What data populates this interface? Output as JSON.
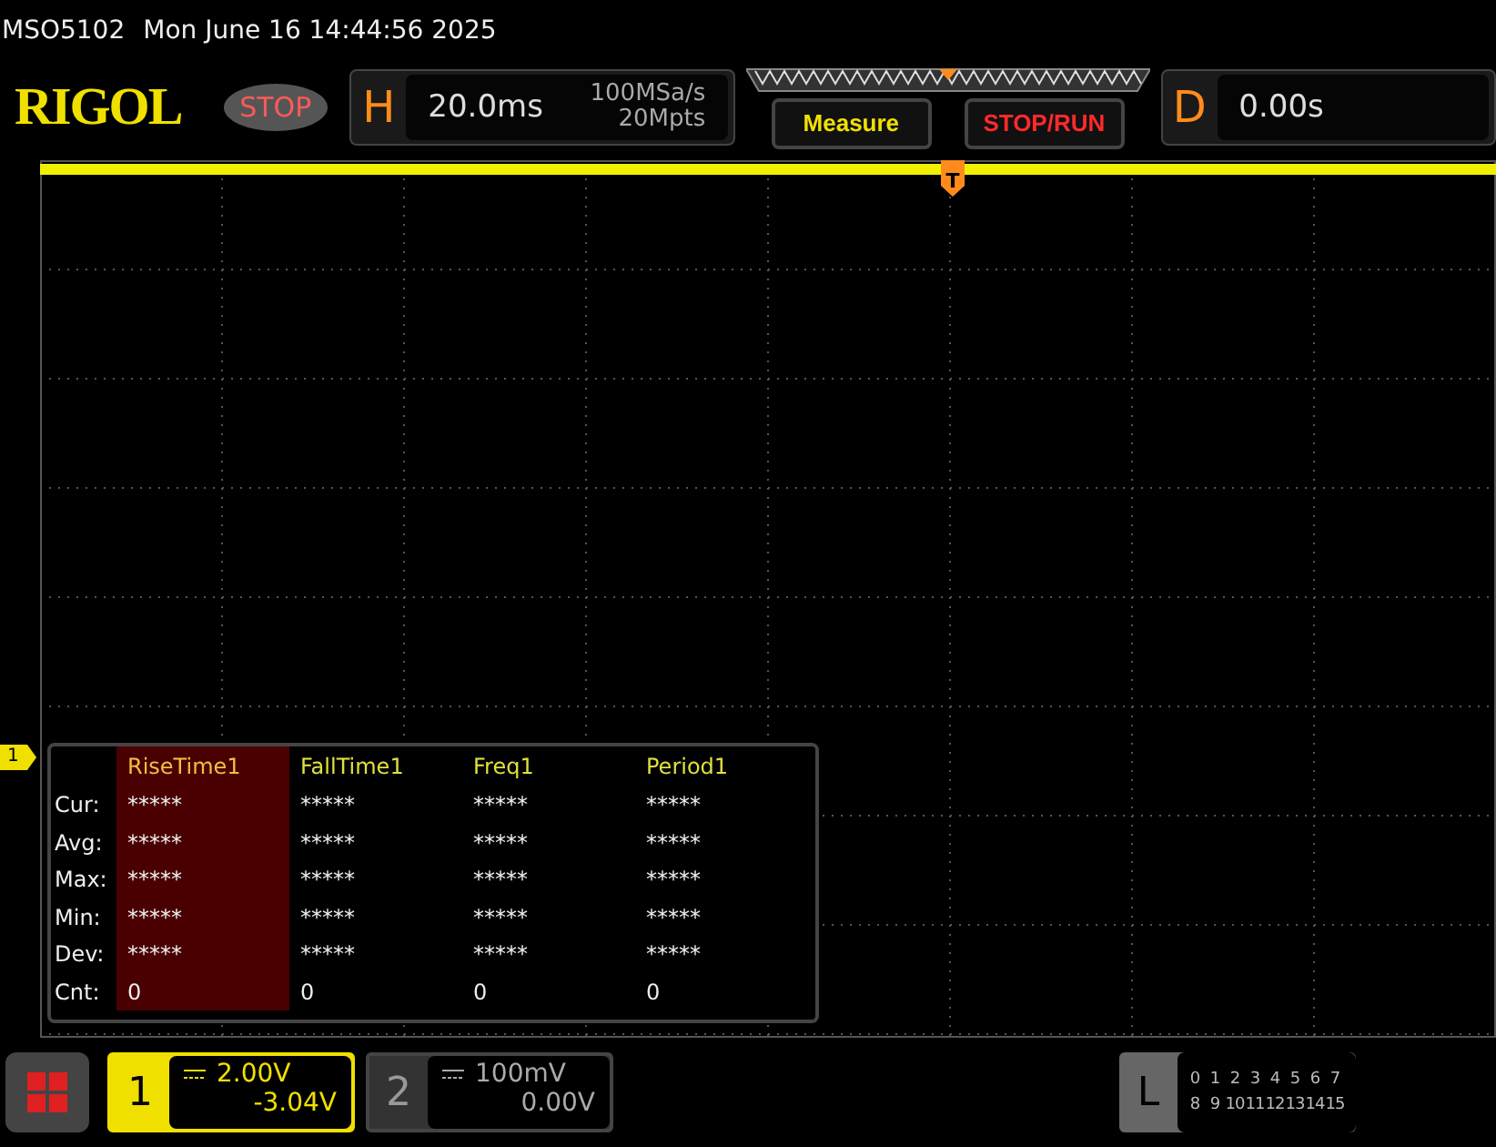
{
  "header": {
    "model": "MSO5102",
    "datetime": "Mon June 16 14:44:56 2025"
  },
  "logo": "RIGOL",
  "run_state": "STOP",
  "horizontal": {
    "label": "H",
    "timebase": "20.0ms",
    "sample_rate": "100MSa/s",
    "memory": "20Mpts"
  },
  "buttons": [
    {
      "label": "Measure",
      "kind": "measure"
    },
    {
      "label": "STOP/RUN",
      "kind": "run"
    }
  ],
  "delay": {
    "label": "D",
    "value": "0.00s"
  },
  "trigger_marker": "T",
  "channel_marker": "1",
  "measure_table": {
    "columns": [
      {
        "label": "RiseTime1",
        "selected": true
      },
      {
        "label": "FallTime1",
        "selected": false
      },
      {
        "label": "Freq1",
        "selected": false
      },
      {
        "label": "Period1",
        "selected": false
      }
    ],
    "rows": [
      {
        "label": "Cur:",
        "values": [
          "*****",
          "*****",
          "*****",
          "*****"
        ]
      },
      {
        "label": "Avg:",
        "values": [
          "*****",
          "*****",
          "*****",
          "*****"
        ]
      },
      {
        "label": "Max:",
        "values": [
          "*****",
          "*****",
          "*****",
          "*****"
        ]
      },
      {
        "label": "Min:",
        "values": [
          "*****",
          "*****",
          "*****",
          "*****"
        ]
      },
      {
        "label": "Dev:",
        "values": [
          "*****",
          "*****",
          "*****",
          "*****"
        ]
      },
      {
        "label": "Cnt:",
        "values": [
          "0",
          "0",
          "0",
          "0"
        ]
      }
    ]
  },
  "channels": [
    {
      "number": "1",
      "scale": "2.00V",
      "offset": "-3.04V",
      "selected": true
    },
    {
      "number": "2",
      "scale": "100mV",
      "offset": "0.00V",
      "selected": false
    }
  ],
  "logic": {
    "label": "L",
    "rows": [
      [
        "0",
        "1",
        "2",
        "3",
        "4",
        "5",
        "6",
        "7"
      ],
      [
        "8",
        "9",
        "10",
        "11",
        "12",
        "13",
        "14",
        "15"
      ]
    ]
  }
}
